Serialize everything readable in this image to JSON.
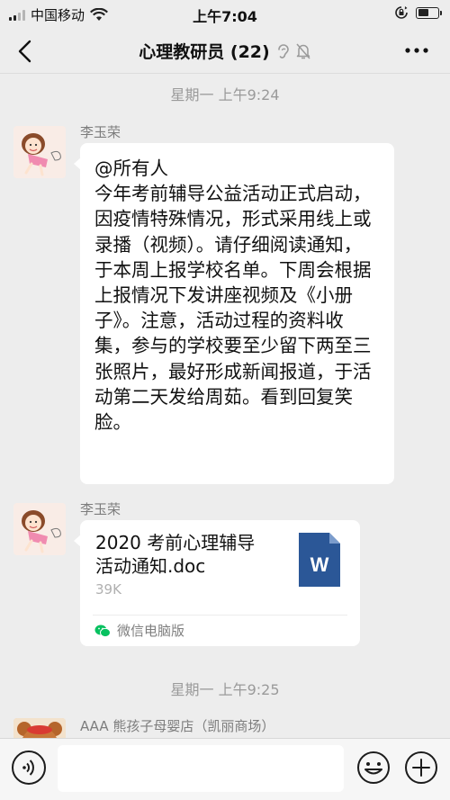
{
  "status_bar": {
    "carrier": "中国移动",
    "time": "上午7:04"
  },
  "nav": {
    "title": "心理教研员 (22)"
  },
  "chat": {
    "timestamps": [
      "星期一 上午9:24",
      "星期一 上午9:25"
    ],
    "messages": [
      {
        "sender": "李玉荣",
        "text": "@所有人\n今年考前辅导公益活动正式启动，因疫情特殊情况，形式采用线上或录播（视频）。请仔细阅读通知，于本周上报学校名单。下周会根据上报情况下发讲座视频及《小册子》。注意，活动过程的资料收集，参与的学校要至少留下两至三张照片，最好形成新闻报道，于活动第二天发给周茹。看到回复笑脸。"
      },
      {
        "sender": "李玉荣",
        "file": {
          "name": "2020 考前心理辅导活动通知.doc",
          "size": "39K",
          "source": "微信电脑版",
          "icon": "word-doc-icon",
          "icon_letter": "W",
          "icon_color": "#2b5797"
        }
      },
      {
        "sender": "AAA 熊孩子母婴店（凯丽商场）"
      }
    ]
  },
  "input_bar": {
    "placeholder": ""
  },
  "colors": {
    "background": "#ededed",
    "bubble": "#ffffff",
    "word_blue": "#2b5797",
    "wechat_green": "#07c160"
  }
}
